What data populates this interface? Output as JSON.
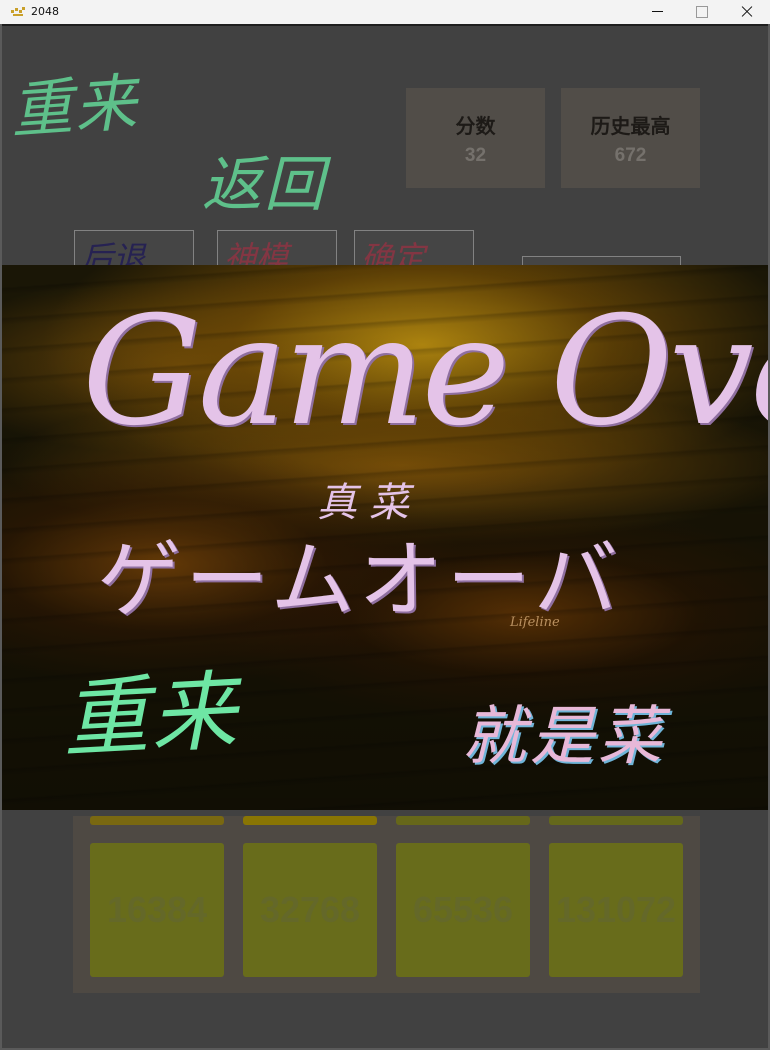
{
  "window": {
    "title": "2048",
    "controls": [
      "minimize-icon",
      "maximize-icon",
      "close-icon"
    ]
  },
  "header": {
    "restart_label": "重来",
    "back_label": "返回",
    "score": {
      "label": "分数",
      "value": "32"
    },
    "best": {
      "label": "历史最高",
      "value": "672"
    }
  },
  "toolbar": {
    "undo_label": "后退",
    "god_label": "神模",
    "confirm_label": "确定"
  },
  "board": {
    "bottom_row": [
      "16384",
      "32768",
      "65536",
      "131072"
    ]
  },
  "game_over": {
    "title": "Game Over",
    "subtitle": "真菜",
    "kana": "ゲームオーバ",
    "watermark": "Lifeline",
    "restart_label": "重来",
    "taunt": "就是菜"
  },
  "colors": {
    "handwriting_green": "#6ee6a4",
    "handwriting_pink": "#e4c3e8",
    "score_box": "#5f5a54",
    "tile_olive": "#7a7f1d"
  }
}
